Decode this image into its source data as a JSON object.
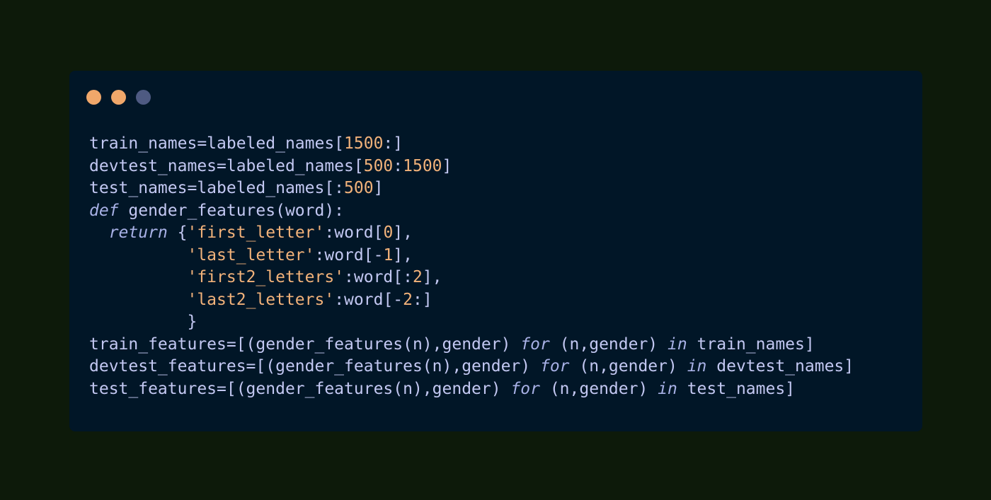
{
  "colors": {
    "page_background": "#0d1a0a",
    "window_background": "#011627",
    "dot_close": "#f0a76a",
    "dot_minimize": "#f0a76a",
    "dot_maximize": "#4e5a82",
    "plain_text": "#c3c8f2",
    "numbers": "#f2b27a",
    "strings": "#f2b27a",
    "keywords": "#a8b1e6"
  },
  "window_controls": [
    {
      "name": "close-dot",
      "color": "#f0a76a"
    },
    {
      "name": "minimize-dot",
      "color": "#f0a76a"
    },
    {
      "name": "maximize-dot",
      "color": "#4e5a82"
    }
  ],
  "code_lines": [
    [
      {
        "t": "plain",
        "v": "train_names=labeled_names["
      },
      {
        "t": "num",
        "v": "1500"
      },
      {
        "t": "plain",
        "v": ":]"
      }
    ],
    [
      {
        "t": "plain",
        "v": "devtest_names=labeled_names["
      },
      {
        "t": "num",
        "v": "500"
      },
      {
        "t": "plain",
        "v": ":"
      },
      {
        "t": "num",
        "v": "1500"
      },
      {
        "t": "plain",
        "v": "]"
      }
    ],
    [
      {
        "t": "plain",
        "v": "test_names=labeled_names[:"
      },
      {
        "t": "num",
        "v": "500"
      },
      {
        "t": "plain",
        "v": "]"
      }
    ],
    [
      {
        "t": "kw",
        "v": "def"
      },
      {
        "t": "plain",
        "v": " gender_features(word):"
      }
    ],
    [
      {
        "t": "plain",
        "v": "  "
      },
      {
        "t": "kw",
        "v": "return"
      },
      {
        "t": "plain",
        "v": " {"
      },
      {
        "t": "str",
        "v": "'first_letter'"
      },
      {
        "t": "plain",
        "v": ":word["
      },
      {
        "t": "num",
        "v": "0"
      },
      {
        "t": "plain",
        "v": "],"
      }
    ],
    [
      {
        "t": "plain",
        "v": "          "
      },
      {
        "t": "str",
        "v": "'last_letter'"
      },
      {
        "t": "plain",
        "v": ":word[-"
      },
      {
        "t": "num",
        "v": "1"
      },
      {
        "t": "plain",
        "v": "],"
      }
    ],
    [
      {
        "t": "plain",
        "v": "          "
      },
      {
        "t": "str",
        "v": "'first2_letters'"
      },
      {
        "t": "plain",
        "v": ":word[:"
      },
      {
        "t": "num",
        "v": "2"
      },
      {
        "t": "plain",
        "v": "],"
      }
    ],
    [
      {
        "t": "plain",
        "v": "          "
      },
      {
        "t": "str",
        "v": "'last2_letters'"
      },
      {
        "t": "plain",
        "v": ":word[-"
      },
      {
        "t": "num",
        "v": "2"
      },
      {
        "t": "plain",
        "v": ":]"
      }
    ],
    [
      {
        "t": "plain",
        "v": "          }"
      }
    ],
    [
      {
        "t": "plain",
        "v": "train_features=[(gender_features(n),gender) "
      },
      {
        "t": "kw",
        "v": "for"
      },
      {
        "t": "plain",
        "v": " (n,gender) "
      },
      {
        "t": "kw",
        "v": "in"
      },
      {
        "t": "plain",
        "v": " train_names]"
      }
    ],
    [
      {
        "t": "plain",
        "v": "devtest_features=[(gender_features(n),gender) "
      },
      {
        "t": "kw",
        "v": "for"
      },
      {
        "t": "plain",
        "v": " (n,gender) "
      },
      {
        "t": "kw",
        "v": "in"
      },
      {
        "t": "plain",
        "v": " devtest_names]"
      }
    ],
    [
      {
        "t": "plain",
        "v": "test_features=[(gender_features(n),gender) "
      },
      {
        "t": "kw",
        "v": "for"
      },
      {
        "t": "plain",
        "v": " (n,gender) "
      },
      {
        "t": "kw",
        "v": "in"
      },
      {
        "t": "plain",
        "v": " test_names]"
      }
    ]
  ]
}
